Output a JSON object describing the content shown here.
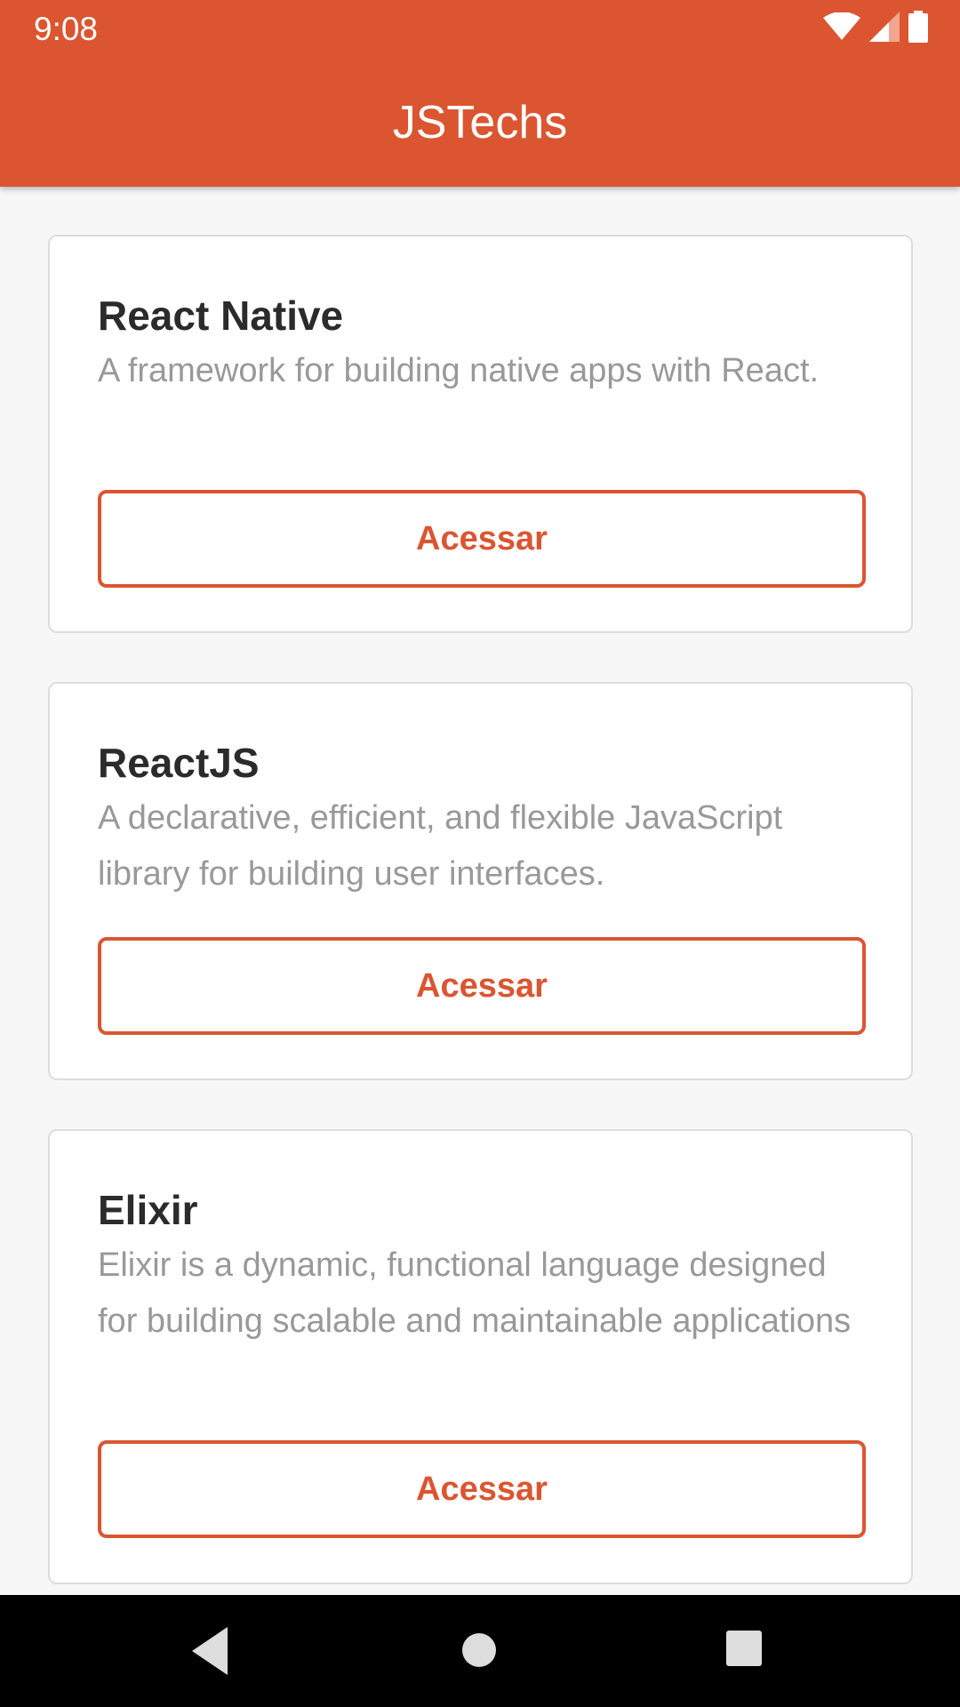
{
  "status_bar": {
    "time": "9:08"
  },
  "header": {
    "title": "JSTechs"
  },
  "cards": [
    {
      "title": "React Native",
      "description": "A framework for building native apps with React.",
      "button_label": "Acessar"
    },
    {
      "title": "ReactJS",
      "description": "A declarative, efficient, and flexible JavaScript library for building user interfaces.",
      "button_label": "Acessar"
    },
    {
      "title": "Elixir",
      "description": "Elixir is a dynamic, functional language designed for building scalable and maintainable applications",
      "button_label": "Acessar"
    }
  ],
  "colors": {
    "accent": "#db5531",
    "background": "#f7f7f7",
    "card": "#ffffff",
    "title_text": "#2b2b2b",
    "description_text": "#999999"
  },
  "icons": {
    "wifi": "wifi-icon",
    "signal": "signal-icon",
    "battery": "battery-icon",
    "back": "back-icon",
    "home": "home-icon",
    "recents": "recents-icon"
  }
}
